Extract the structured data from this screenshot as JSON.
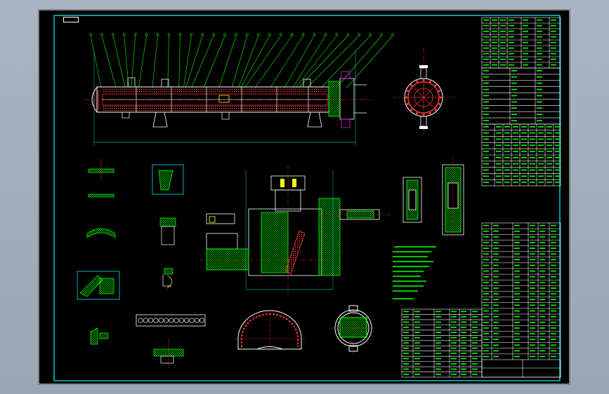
{
  "viewport": {
    "background": "#000000",
    "page_background": "#a3afbd"
  },
  "palette": {
    "frame": "#00ffff",
    "line": "#ffffff",
    "leader": "#00ff00",
    "hatch": "#ff3030",
    "center": "#ff2020",
    "dim": "#00ffff",
    "accent_yellow": "#ffff00",
    "accent_magenta": "#ff00ff",
    "accent_blue": "#3060ff",
    "text_green": "#00ff00"
  },
  "title_tag": "",
  "balloon_count_top": 28,
  "views": [
    "main-elevation",
    "end-view-flange",
    "detail-1",
    "detail-2",
    "detail-3",
    "detail-4",
    "detail-5",
    "detail-6",
    "detail-7",
    "detail-8",
    "detail-9",
    "detail-10",
    "detail-11",
    "section-center",
    "detail-right-1",
    "detail-right-2",
    "notes-block",
    "half-section-arch",
    "circular-section",
    "nozzle-table",
    "design-data-table",
    "parts-list",
    "title-block"
  ]
}
